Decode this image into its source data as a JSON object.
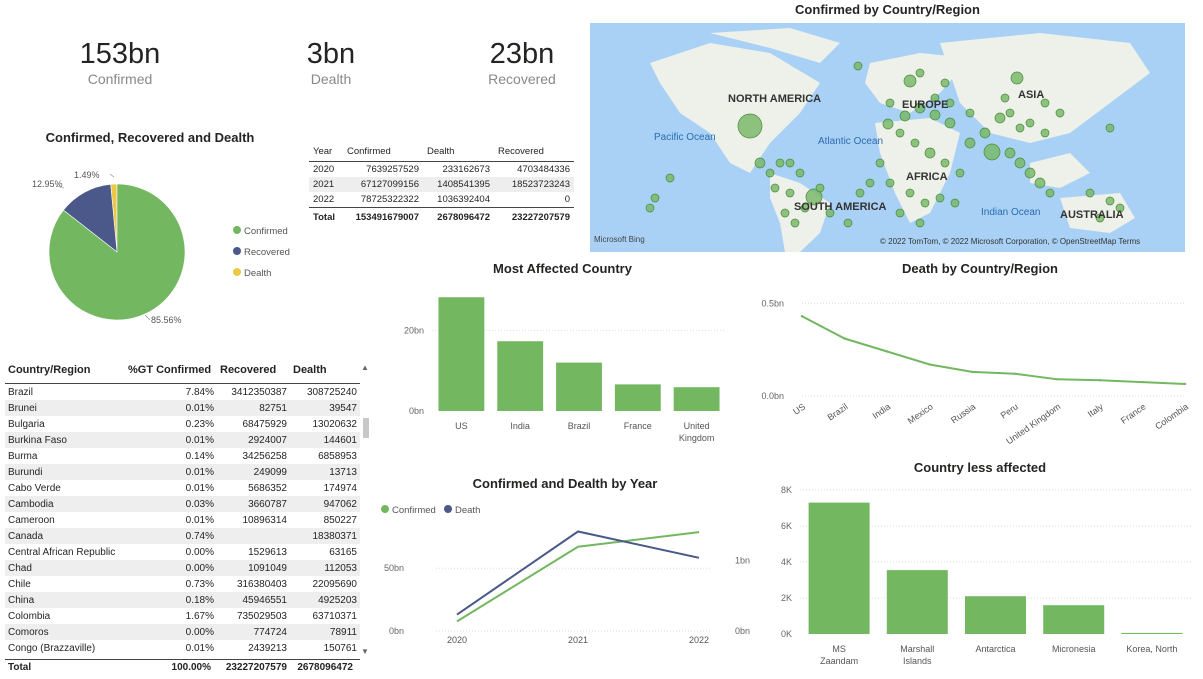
{
  "kpis": [
    {
      "value": "153bn",
      "label": "Confirmed"
    },
    {
      "value": "3bn",
      "label": "Dealth"
    },
    {
      "value": "23bn",
      "label": "Recovered"
    }
  ],
  "map": {
    "title": "Confirmed by Country/Region",
    "labels": {
      "north_america": "NORTH AMERICA",
      "europe": "EUROPE",
      "asia": "ASIA",
      "pacific": "Pacific Ocean",
      "atlantic": "Atlantic Ocean",
      "africa": "AFRICA",
      "south_america": "SOUTH AMERICA",
      "indian": "Indian Ocean",
      "australia": "AUSTRALIA"
    },
    "bing": "Microsoft Bing",
    "copyright": "© 2022 TomTom, © 2022 Microsoft Corporation, © OpenStreetMap  Terms"
  },
  "pie": {
    "title": "Confirmed, Recovered and Dealth",
    "legend": [
      {
        "label": "Confirmed",
        "color": "#73b761"
      },
      {
        "label": "Recovered",
        "color": "#4a588a"
      },
      {
        "label": "Dealth",
        "color": "#ecc846"
      }
    ],
    "pct_labels": {
      "confirmed": "85.56%",
      "recovered": "12.95%",
      "death": "1.49%"
    }
  },
  "year_table": {
    "headers": [
      "Year",
      "Confirmed",
      "Dealth",
      "Recovered"
    ],
    "rows": [
      [
        "2020",
        "7639257529",
        "233162673",
        "4703484336"
      ],
      [
        "2021",
        "67127099156",
        "1408541395",
        "18523723243"
      ],
      [
        "2022",
        "78725322322",
        "1036392404",
        "0"
      ]
    ],
    "total": [
      "Total",
      "153491679007",
      "2678096472",
      "23227207579"
    ]
  },
  "country_table": {
    "headers": [
      "Country/Region",
      "%GT Confirmed",
      "Recovered",
      "Dealth"
    ],
    "rows": [
      [
        "Brazil",
        "7.84%",
        "3412350387",
        "308725240"
      ],
      [
        "Brunei",
        "0.01%",
        "82751",
        "39547"
      ],
      [
        "Bulgaria",
        "0.23%",
        "68475929",
        "13020632"
      ],
      [
        "Burkina Faso",
        "0.01%",
        "2924007",
        "144601"
      ],
      [
        "Burma",
        "0.14%",
        "34256258",
        "6858953"
      ],
      [
        "Burundi",
        "0.01%",
        "249099",
        "13713"
      ],
      [
        "Cabo Verde",
        "0.01%",
        "5686352",
        "174974"
      ],
      [
        "Cambodia",
        "0.03%",
        "3660787",
        "947062"
      ],
      [
        "Cameroon",
        "0.01%",
        "10896314",
        "850227"
      ],
      [
        "Canada",
        "0.74%",
        "",
        "18380371"
      ],
      [
        "Central African Republic",
        "0.00%",
        "1529613",
        "63165"
      ],
      [
        "Chad",
        "0.00%",
        "1091049",
        "112053"
      ],
      [
        "Chile",
        "0.73%",
        "316380403",
        "22095690"
      ],
      [
        "China",
        "0.18%",
        "45946551",
        "4925203"
      ],
      [
        "Colombia",
        "1.67%",
        "735029503",
        "63710371"
      ],
      [
        "Comoros",
        "0.00%",
        "774724",
        "78911"
      ],
      [
        "Congo (Brazzaville)",
        "0.01%",
        "2439213",
        "150761"
      ]
    ],
    "total": [
      "Total",
      "100.00%",
      "23227207579",
      "2678096472"
    ]
  },
  "charts": {
    "most_affected": {
      "title": "Most Affected Country"
    },
    "death_by_country": {
      "title": "Death by Country/Region"
    },
    "by_year": {
      "title": "Confirmed and Dealth by Year",
      "legend": [
        "Confirmed",
        "Death"
      ]
    },
    "less_affected": {
      "title": "Country less affected"
    }
  },
  "chart_data": [
    {
      "type": "pie",
      "title": "Confirmed, Recovered and Dealth",
      "categories": [
        "Confirmed",
        "Recovered",
        "Dealth"
      ],
      "values": [
        85.56,
        12.95,
        1.49
      ],
      "colors": [
        "#73b761",
        "#4a588a",
        "#ecc846"
      ],
      "legend": "right"
    },
    {
      "type": "bar",
      "title": "Most Affected Country",
      "categories": [
        "US",
        "India",
        "Brazil",
        "France",
        "United Kingdom"
      ],
      "values": [
        28.2,
        17.3,
        12.0,
        6.6,
        5.9
      ],
      "unit": "bn",
      "ylim": [
        0,
        30
      ],
      "yticks": [
        "0bn",
        "20bn"
      ],
      "color": "#73b761"
    },
    {
      "type": "line",
      "title": "Death by Country/Region",
      "categories": [
        "US",
        "Brazil",
        "India",
        "Mexico",
        "Russia",
        "Peru",
        "United Kingdom",
        "Italy",
        "France",
        "Colombia"
      ],
      "values": [
        0.43,
        0.31,
        0.24,
        0.17,
        0.13,
        0.12,
        0.09,
        0.085,
        0.075,
        0.065
      ],
      "unit": "bn",
      "ylim": [
        0,
        0.55
      ],
      "yticks": [
        "0.0bn",
        "0.5bn"
      ],
      "color": "#73b761"
    },
    {
      "type": "line",
      "title": "Confirmed and Dealth by Year",
      "x": [
        "2020",
        "2021",
        "2022"
      ],
      "series": [
        {
          "name": "Confirmed",
          "values": [
            7.64,
            67.13,
            78.73
          ],
          "unit": "bn",
          "axis": "left",
          "color": "#73b761"
        },
        {
          "name": "Death",
          "values": [
            0.233,
            1.409,
            1.036
          ],
          "unit": "bn",
          "axis": "right",
          "color": "#4a588a"
        }
      ],
      "yticks_left": [
        "0bn",
        "50bn"
      ],
      "yticks_right": [
        "0bn",
        "1bn"
      ],
      "legend": "top-left"
    },
    {
      "type": "bar",
      "title": "Country less affected",
      "categories": [
        "MS Zaandam",
        "Marshall Islands",
        "Antarctica",
        "Micronesia",
        "Korea, North"
      ],
      "values": [
        7300,
        3550,
        2100,
        1600,
        60
      ],
      "ylim": [
        0,
        8000
      ],
      "yticks": [
        "0K",
        "2K",
        "4K",
        "6K",
        "8K"
      ],
      "color": "#73b761"
    }
  ]
}
